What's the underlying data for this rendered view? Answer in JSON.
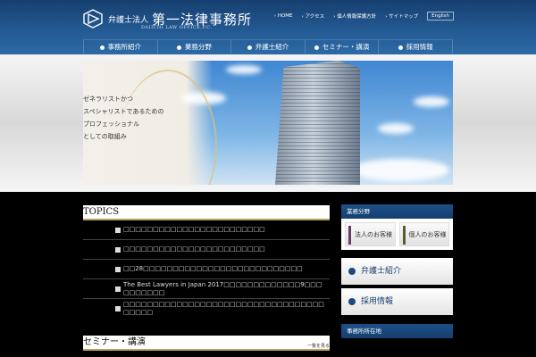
{
  "header": {
    "logo_small": "弁護士法人",
    "logo_main": "第一法律事務所",
    "logo_en": "DAIICHI LAW OFFICE,P.C.",
    "util_links": [
      "HOME",
      "アクセス",
      "個人情報保護方針",
      "サイトマップ"
    ],
    "english": "English"
  },
  "nav": [
    "事務所紹介",
    "業務分野",
    "弁護士紹介",
    "セミナー・講演",
    "採用情報"
  ],
  "hero": {
    "lines": [
      "ゼネラリストかつ",
      "スペシャリストであるための",
      "プロフェッショナル",
      "としての取組み"
    ]
  },
  "topics": {
    "title": "TOPICS",
    "items": [
      "□□□□□□□□□□□□□□□□□□□□□□□□",
      "□□□□□□□□□□□□□□□□□□□□□□□□",
      "□□28□□□□□□□□□□□□□□□□□□□□□□□□□□□",
      "The Best Lawyers in Japan 2017□□□□□□□□□□□□□9□□□□□□□□□□",
      "□□□□□□□□□□□□□□□□□□□□□□□□□□□□□□□□□□□□□□□"
    ]
  },
  "seminar": {
    "title": "セミナー・講演",
    "more": "一覧を見る"
  },
  "sidebar": {
    "practice_title": "業務分野",
    "corporate": "法人のお客様",
    "individual": "個人のお客様",
    "lawyers": "弁護士紹介",
    "recruit": "採用情報",
    "location_title": "事務所所在地"
  }
}
